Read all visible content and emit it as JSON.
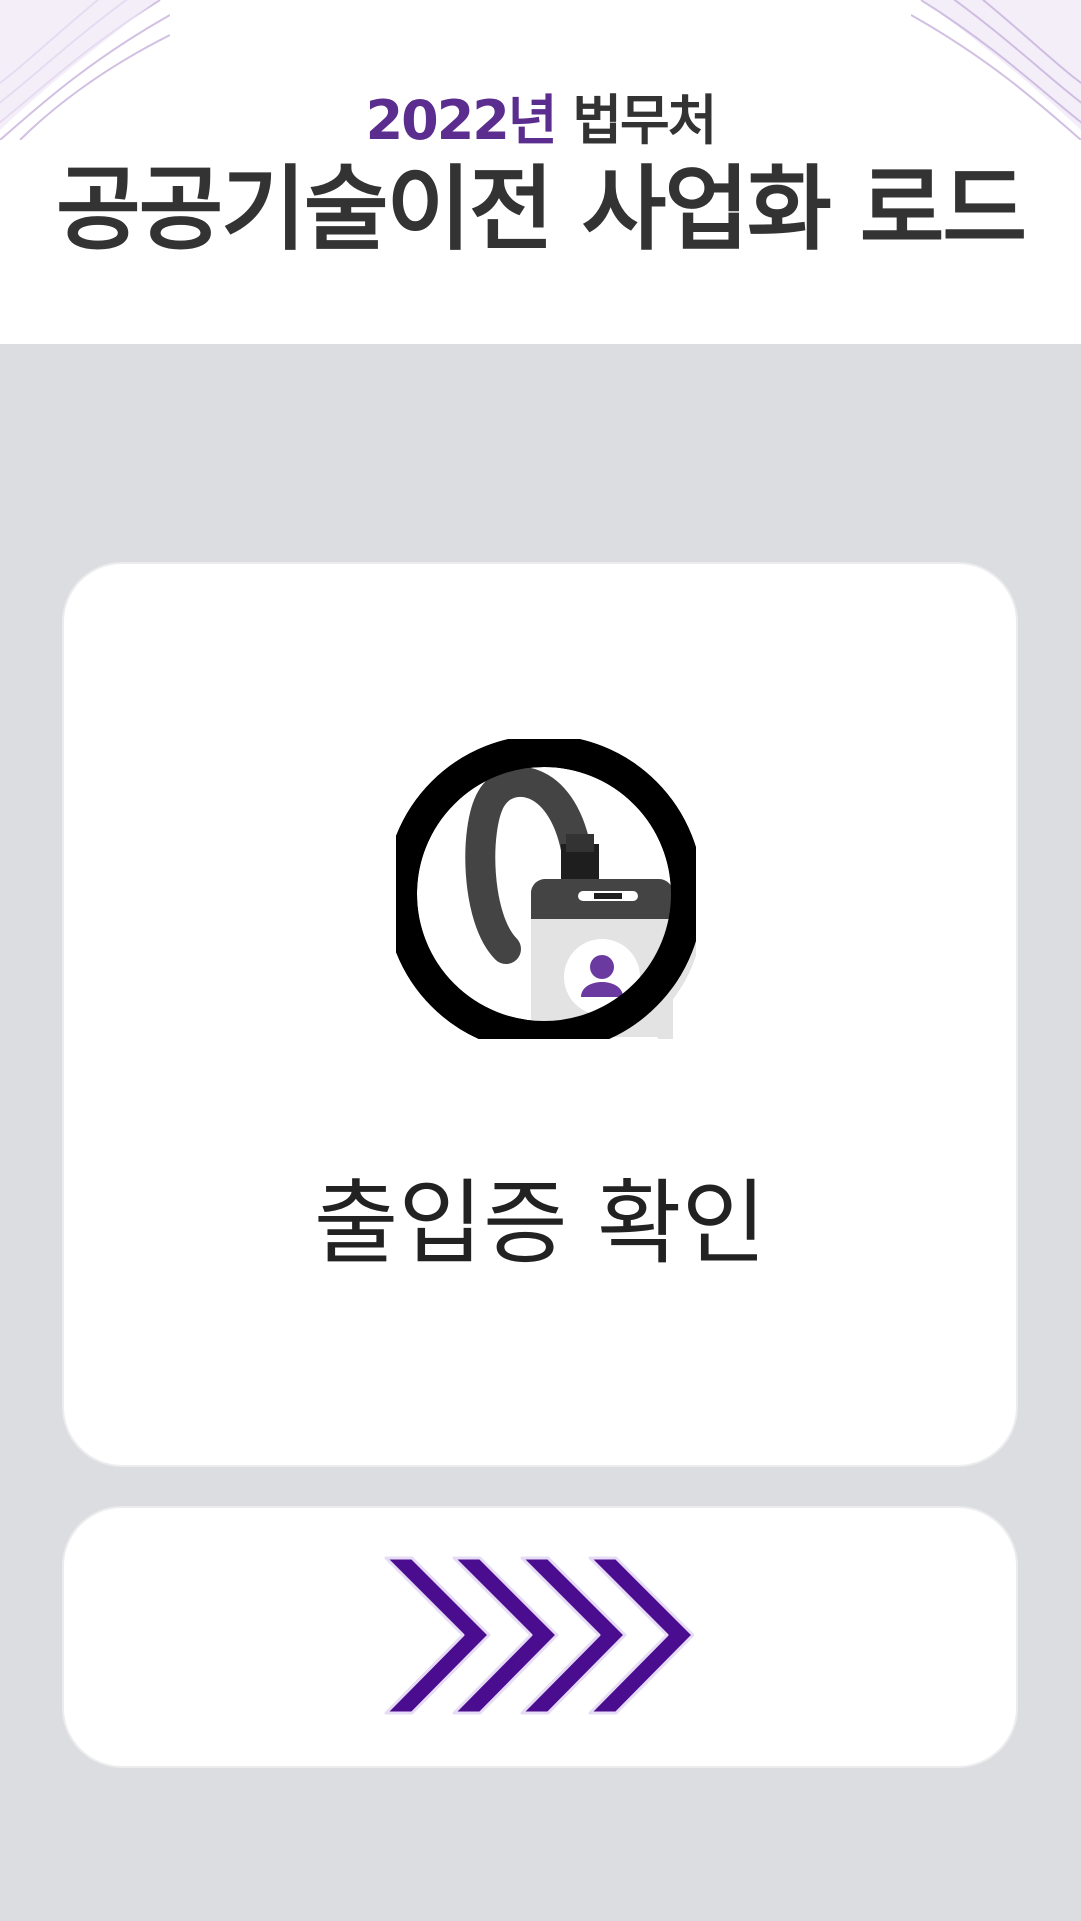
{
  "header": {
    "year": "2022년",
    "org": "법무처",
    "title": "공공기술이전 사업화 로드"
  },
  "card": {
    "icon": "id-badge-icon",
    "label": "출입증 확인"
  },
  "next_button": {
    "icon": "chevron-right-arrows-icon"
  },
  "colors": {
    "accent": "#5b2d8e",
    "arrow": "#4b0d8f",
    "background": "#dcdde1",
    "text": "#333333"
  }
}
